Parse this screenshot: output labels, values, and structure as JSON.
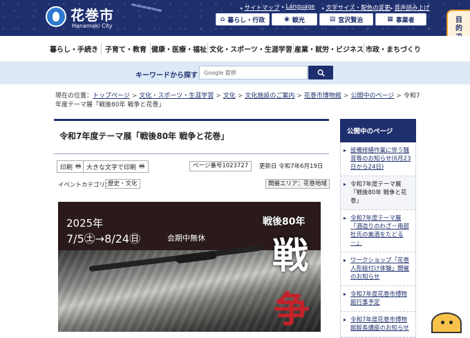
{
  "header": {
    "site_title": "花巻市",
    "site_subtitle": "Hanamaki City",
    "utility_links": [
      "サイトマップ",
      "Language",
      "文字サイズ・配色の変更",
      "音声読み上げ"
    ],
    "buttons": [
      {
        "icon": "house-icon",
        "label": "暮らし・行政"
      },
      {
        "icon": "camera-icon",
        "label": "観光"
      },
      {
        "icon": "book-icon",
        "label": "宮沢賢治"
      },
      {
        "icon": "building-icon",
        "label": "事業者"
      }
    ]
  },
  "side_tab": {
    "label": "目的で探す"
  },
  "nav": {
    "items": [
      "暮らし・手続き",
      "子育て・教育",
      "健康・医療・福祉",
      "文化・スポーツ・生涯学習",
      "産業・就労・ビジネス",
      "市政・まちづくり"
    ]
  },
  "search": {
    "label": "キーワードから探す",
    "placeholder": "Google 提供"
  },
  "breadcrumb": {
    "prefix": "現在の位置：",
    "links": [
      "トップページ",
      "文化・スポーツ・生涯学習",
      "文化",
      "文化施設のご案内",
      "花巻市博物館",
      "公開中のページ"
    ],
    "current": "令和7年度テーマ展「戦後80年 戦争と花巻」"
  },
  "article": {
    "title": "令和7年度テーマ展「戦後80年 戦争と花巻」",
    "print_label": "印刷",
    "large_print_label": "大きな文字で印刷",
    "page_number": "ページ番号1023727",
    "updated": "更新日 令和7年6月19日",
    "category_label": "イベントカテゴリ：",
    "category": "歴史・文化",
    "area": "開催エリア：花巻地域"
  },
  "poster": {
    "year": "2025年",
    "dates": "7/5㊏→8/24㊐",
    "open": "会期中無休",
    "tagline": "戦後80年",
    "big_char1": "戦",
    "big_char2": "争"
  },
  "sidebar": {
    "heading": "公開中のページ",
    "items": [
      "設備修繕作業に伴う騒音等のお知らせ(6月23日から24日)",
      "令和7年度テーマ展「戦後80年 戦争と花巻」",
      "令和7年度テーマ展「酒造りのわざ－南部杜氏の美酒をたどる－」",
      "ワークショップ「花巻人形絵付け体験」開催のお知らせ",
      "令和7年度花巻市博物館行事予定",
      "令和7年度花巻市博物館館長講座のお知らせ"
    ]
  },
  "colors": {
    "navy": "#1e2f6e",
    "search_band": "#dde9f7",
    "accent_orange": "#f2a22b",
    "poster_red": "#c5222a"
  }
}
